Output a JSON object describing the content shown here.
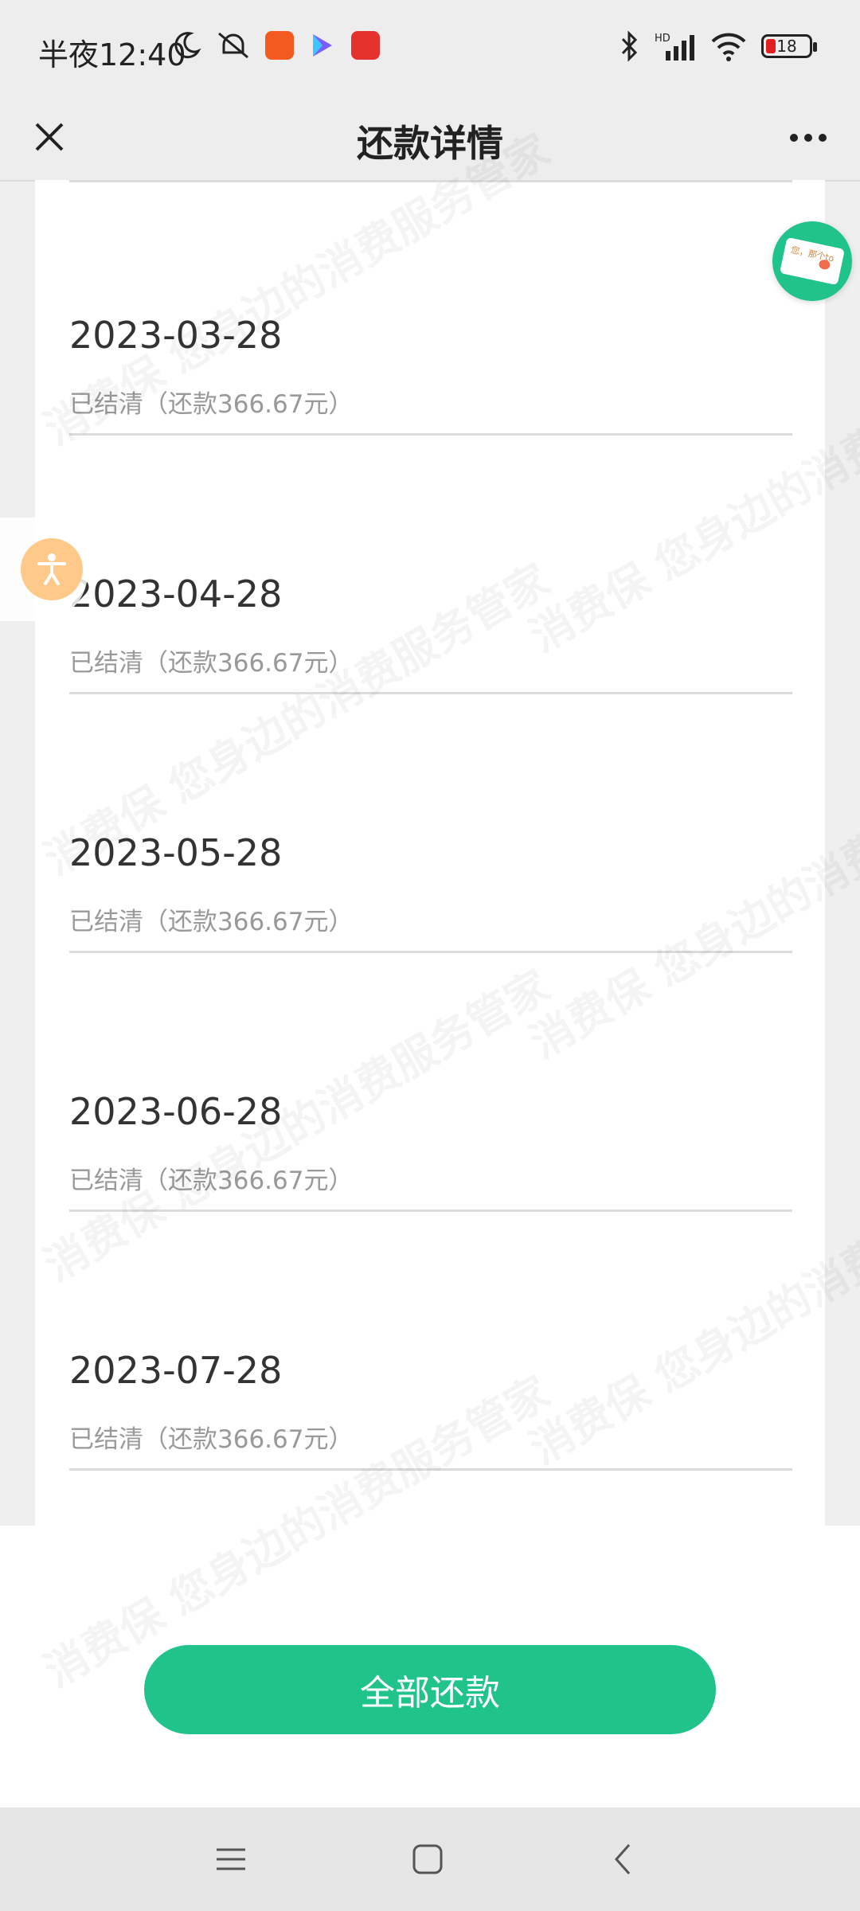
{
  "status_bar": {
    "time": "半夜12:40",
    "battery": "18",
    "app_icons": [
      "crescent-moon-icon",
      "muted-bell-icon",
      "kuaishou-icon",
      "play-store-icon",
      "kandian-app-icon"
    ],
    "right_icons": [
      "bluetooth-icon",
      "hd-signal-icon",
      "wifi-icon",
      "battery-icon"
    ]
  },
  "navbar": {
    "title": "还款详情"
  },
  "installments": [
    {
      "date": "2023-03-28",
      "status": "已结清（还款366.67元）"
    },
    {
      "date": "2023-04-28",
      "status": "已结清（还款366.67元）"
    },
    {
      "date": "2023-05-28",
      "status": "已结清（还款366.67元）"
    },
    {
      "date": "2023-06-28",
      "status": "已结清（还款366.67元）"
    },
    {
      "date": "2023-07-28",
      "status": "已结清（还款366.67元）"
    }
  ],
  "pay_button": {
    "label": "全部还款"
  },
  "floating": {
    "mail_note": "您，那个to"
  },
  "watermark": {
    "text": "消费保 您身边的消费服务管家"
  },
  "colors": {
    "accent": "#20c38a",
    "background": "#efefef",
    "secondary_text": "#999999"
  }
}
